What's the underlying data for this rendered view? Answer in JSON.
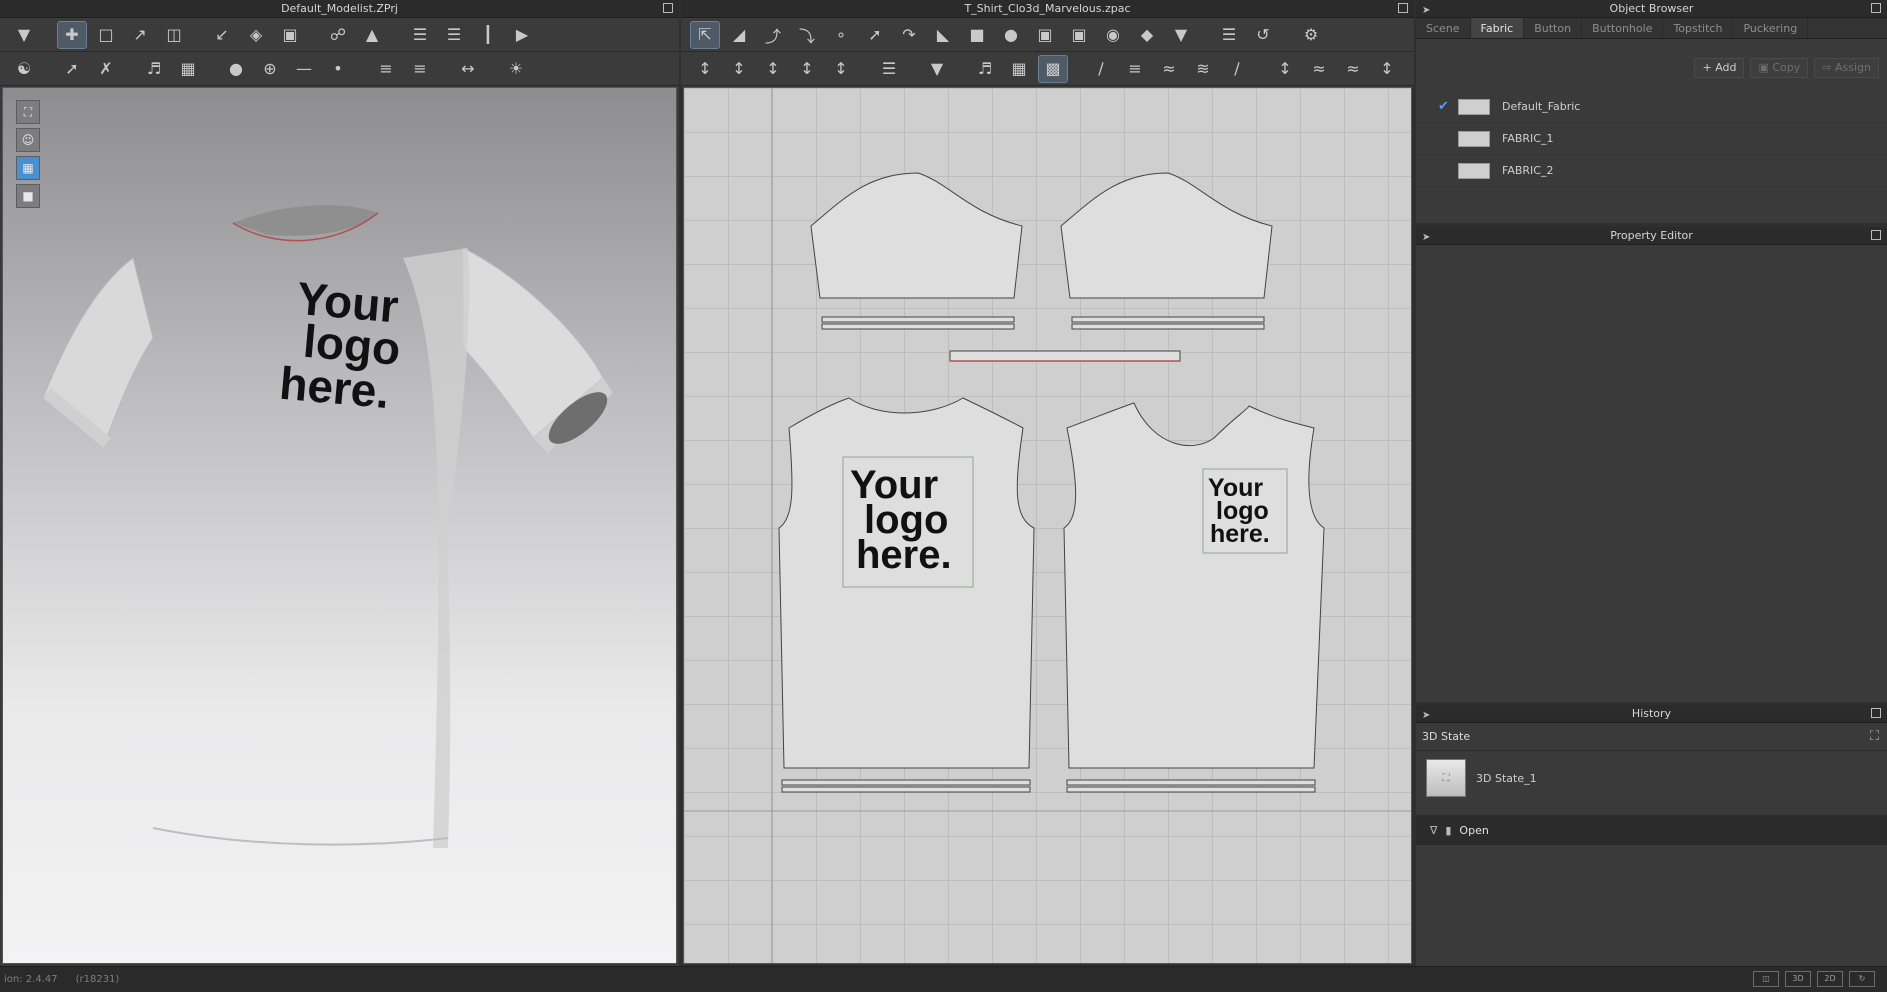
{
  "windows": {
    "left_title": "Default_Modelist.ZPrj",
    "center_title": "T_Shirt_Clo3d_Marvelous.zpac",
    "object_browser_title": "Object Browser",
    "property_editor_title": "Property Editor",
    "history_title": "History"
  },
  "object_browser": {
    "tabs": [
      "Scene",
      "Fabric",
      "Button",
      "Buttonhole",
      "Topstitch",
      "Puckering"
    ],
    "active_tab": "Fabric",
    "actions": {
      "add": "Add",
      "copy": "Copy",
      "assign": "Assign"
    },
    "fabrics": [
      {
        "name": "Default_Fabric",
        "checked": true
      },
      {
        "name": "FABRIC_1",
        "checked": false
      },
      {
        "name": "FABRIC_2",
        "checked": false
      }
    ]
  },
  "history": {
    "section_label": "3D State",
    "state_item": "3D State_1",
    "open_label": "Open"
  },
  "logo": {
    "line1": "Your",
    "line2": "logo",
    "line3": "here."
  },
  "statusbar": {
    "version": "ion: 2.4.47",
    "build": "(r18231)",
    "view_3d": "3D",
    "view_2d": "2D"
  },
  "colors": {
    "accent": "#4aa3ff",
    "shirt": "#e6e6e6",
    "seam": "#b05050"
  }
}
